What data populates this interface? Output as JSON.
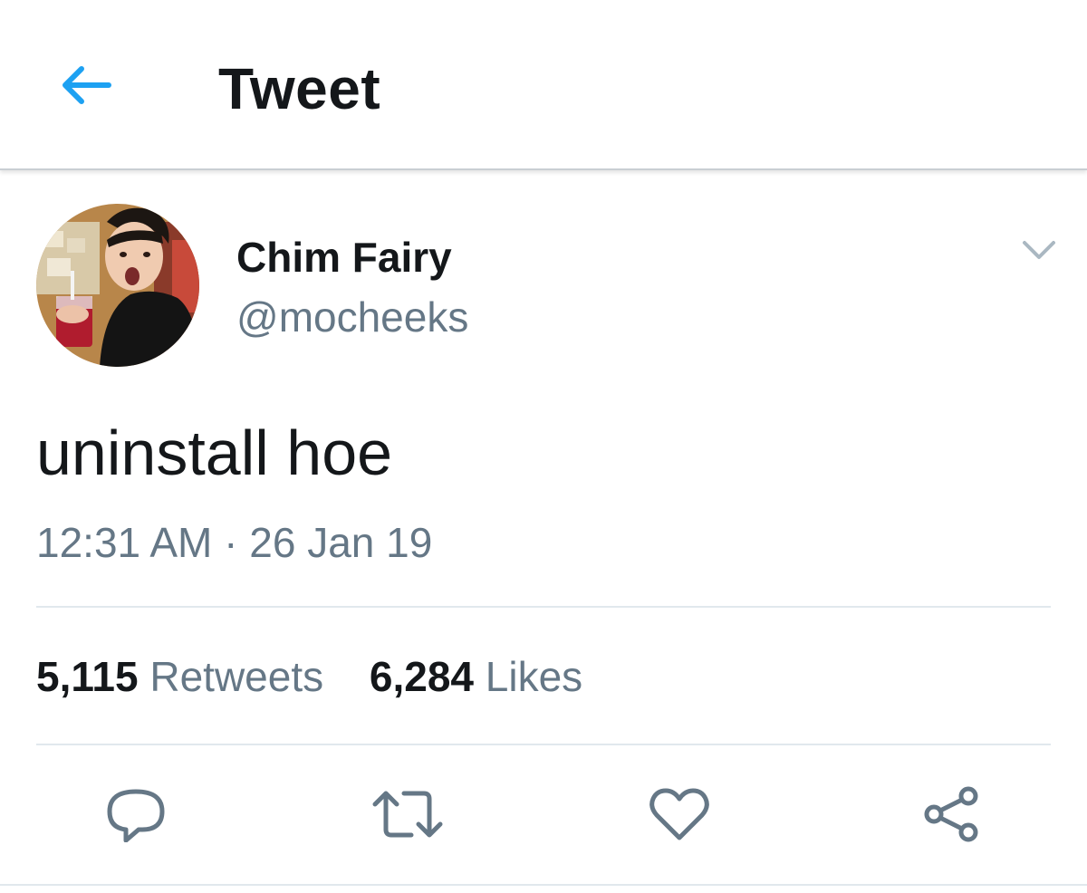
{
  "header": {
    "title": "Tweet",
    "back_icon": "arrow-left-icon",
    "accent_color": "#1da1f2"
  },
  "author": {
    "display_name": "Chim Fairy",
    "handle": "@mocheeks",
    "menu_icon": "chevron-down-icon"
  },
  "tweet": {
    "text": "uninstall hoe",
    "time": "12:31 AM",
    "separator": "·",
    "date": "26 Jan 19"
  },
  "stats": {
    "retweets_count": "5,115",
    "retweets_label": "Retweets",
    "likes_count": "6,284",
    "likes_label": "Likes"
  },
  "actions": [
    "reply-icon",
    "retweet-icon",
    "like-icon",
    "share-icon"
  ],
  "colors": {
    "text_primary": "#14171a",
    "text_secondary": "#657786",
    "divider": "#e1e8ed",
    "icon": "#657786"
  }
}
